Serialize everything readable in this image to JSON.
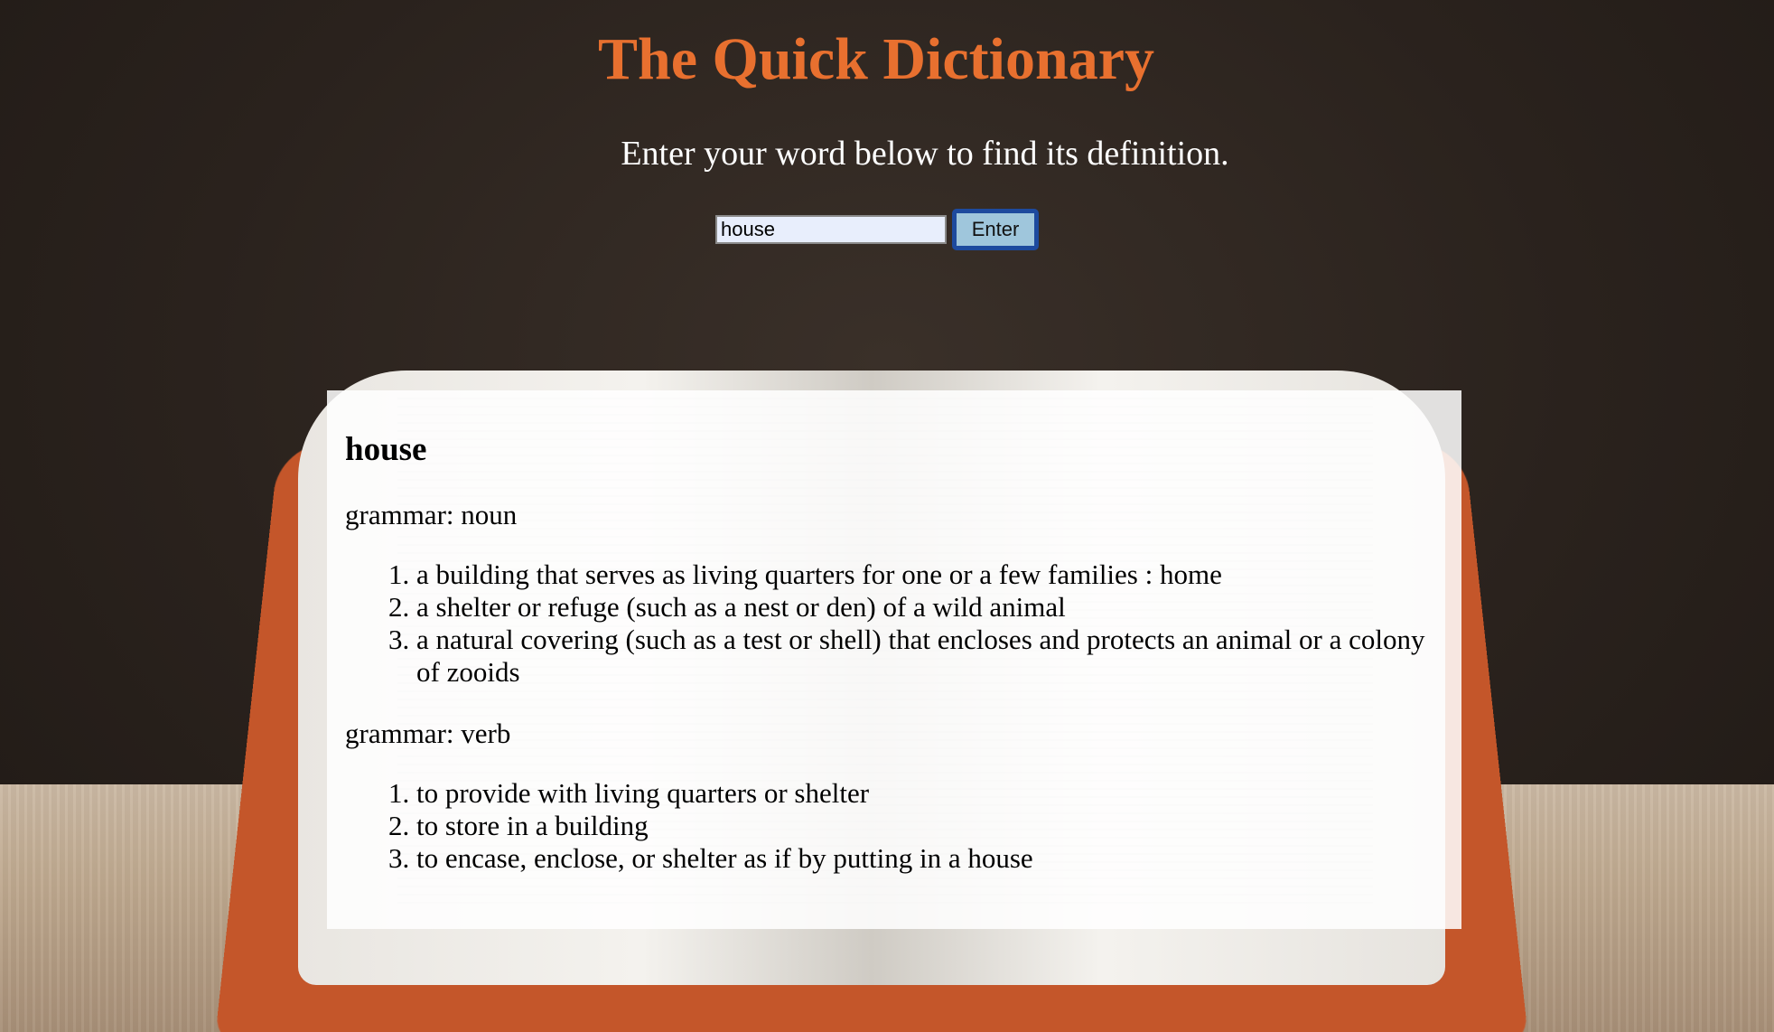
{
  "header": {
    "title": "The Quick Dictionary",
    "subtitle": "Enter your word below to find its definition."
  },
  "search": {
    "value": "house",
    "button_label": "Enter"
  },
  "result": {
    "word": "house",
    "entries": [
      {
        "grammar": "grammar: noun",
        "definitions": [
          "a building that serves as living quarters for one or a few families : home",
          "a shelter or refuge (such as a nest or den) of a wild animal",
          "a natural covering (such as a test or shell) that encloses and protects an animal or a colony of zooids"
        ]
      },
      {
        "grammar": "grammar: verb",
        "definitions": [
          "to provide with living quarters or shelter",
          "to store in a building",
          "to encase, enclose, or shelter as if by putting in a house"
        ]
      }
    ]
  },
  "colors": {
    "title": "#e8702f",
    "button_border": "#1d4a9e",
    "button_bg": "#9fc6dc",
    "input_bg": "#e8eefc"
  }
}
